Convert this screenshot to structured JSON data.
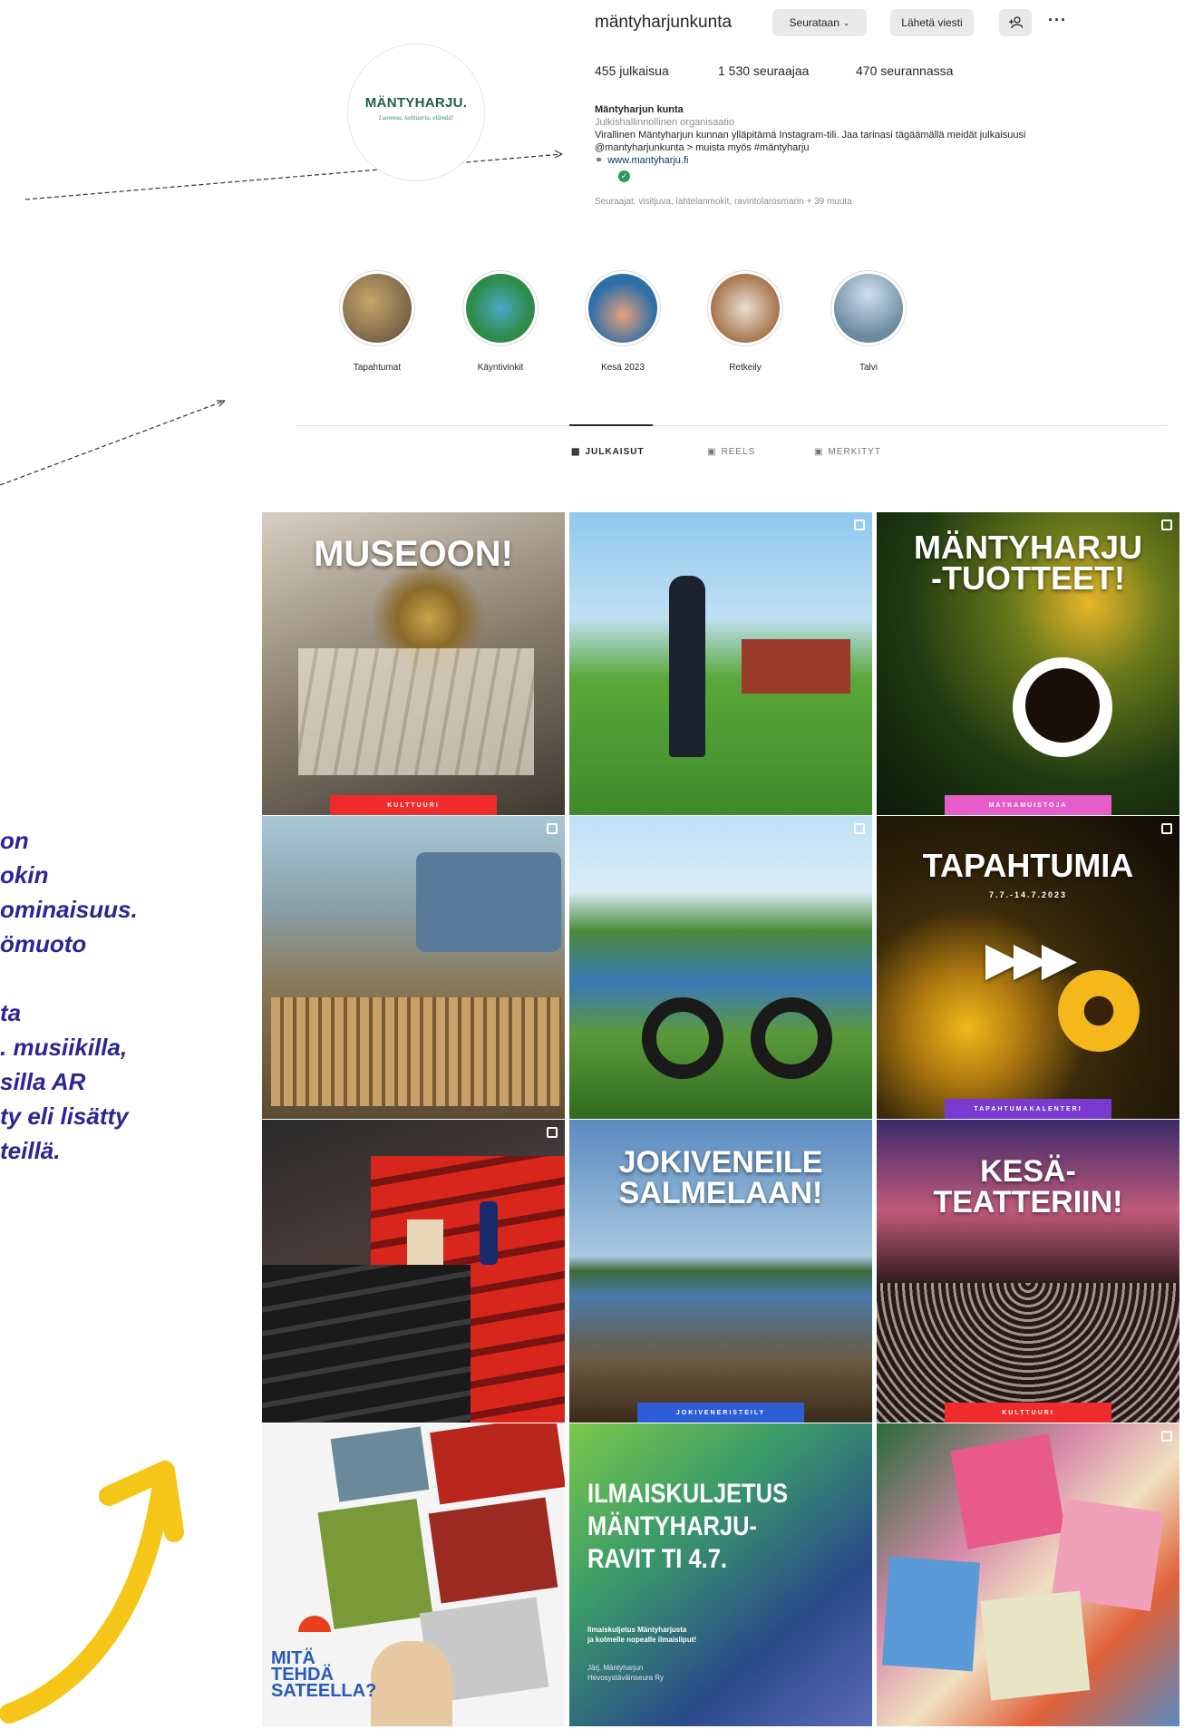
{
  "profile": {
    "username": "mantyharjunkunta",
    "username_display": "mäntyharjunkunta",
    "follow_button": "Seurataan",
    "message_button": "Lähetä viesti",
    "add_person": "+R",
    "more": "···",
    "posts": "455 julkaisua",
    "followers": "1 530 seuraajaa",
    "following": "470 seurannassa",
    "name": "Mäntyharjun kunta",
    "category": "Julkishallinnollinen organisaatio",
    "bio1": "Virallinen Mäntyharjun kunnan ylläpitämä Instagram-tili. Jaa tarinasi tägäämällä meidät julkaisuusi",
    "bio2": "@mantyharjunkunta > muista myös #mäntyharju",
    "link": "www.mantyharju.fi",
    "followed_by": "Seuraajat: visitjuva, lahtelanmokit, ravintolarosmarin",
    "followed_more": "+ 39 muuta",
    "logo_text": "MÄNTYHARJU.",
    "logo_sub": "Luonnoa, kulttuuria, elämää!"
  },
  "highlights": [
    {
      "label": "Tapahtumat",
      "color": "#6a5a4a"
    },
    {
      "label": "Käyntivinkit",
      "color": "#2e8c4a"
    },
    {
      "label": "Kesä 2023",
      "color": "#2f6fa8"
    },
    {
      "label": "Retkeily",
      "color": "#a8744c"
    },
    {
      "label": "Talvi",
      "color": "#8fa6b8"
    }
  ],
  "tabs": [
    "JULKAISUT",
    "REELS",
    "MERKITYT"
  ],
  "posts": [
    {
      "title": "MUSEOON!",
      "ribbon": "KULTTUURI",
      "ribbon_color": "#ef2b2b",
      "bg": "#8a7d6c"
    },
    {
      "title": "",
      "ribbon": "",
      "ribbon_color": "",
      "bg": "#4a9a3a"
    },
    {
      "title": "MÄNTYHARJU\n-TUOTTEET!",
      "ribbon": "MATKAMUISTOJA",
      "ribbon_color": "#e65cc8",
      "bg": "#304a1a"
    },
    {
      "title": "",
      "ribbon": "",
      "ribbon_color": "",
      "bg": "#8a7a5a"
    },
    {
      "title": "",
      "ribbon": "",
      "ribbon_color": "",
      "bg": "#3b7a2a"
    },
    {
      "title": "TAPAHTUMIA",
      "subtitle": "7.7.-14.7.2023",
      "ribbon": "TAPAHTUMAKALENTERI",
      "ribbon_color": "#7a3ad0",
      "bg": "#2a2210"
    },
    {
      "title": "",
      "ribbon": "",
      "ribbon_color": "",
      "bg": "#3a2a2a"
    },
    {
      "title": "JOKIVENEILE\nSALMELAAN!",
      "ribbon": "JOKIVENERISTEILY",
      "ribbon_color": "#2e5bd6",
      "bg": "#4a78a8"
    },
    {
      "title": "KESÄ-\nTEATTERIIN!",
      "ribbon": "KULTTUURI",
      "ribbon_color": "#ef2b2b",
      "bg": "#6a3a5a"
    },
    {
      "title": "MITÄ\nTEHDÄ\nSATEELLA?",
      "ribbon": "",
      "ribbon_color": "",
      "bg": "#f2f2f2"
    },
    {
      "title": "ILMAISKULJETUS\nMÄNTYHARJU-\nRAVIT TI 4.7.",
      "desc": "Ilmaiskuljetus Mäntyharjusta\nja kolmelle nopealle ilmaisliput!",
      "org": "Järj. Mäntyharjun\nHevosystäväinseura Ry",
      "ribbon": "",
      "ribbon_color": "",
      "bg": "#3a7a5a"
    },
    {
      "title": "",
      "ribbon": "",
      "ribbon_color": "",
      "bg": "#d67aa0"
    }
  ],
  "side_text": "on\nokin\nominaisuus.\nömuoto\n\nta\n. musiikilla,\nsilla AR\nty eli lisätty\nteillä."
}
